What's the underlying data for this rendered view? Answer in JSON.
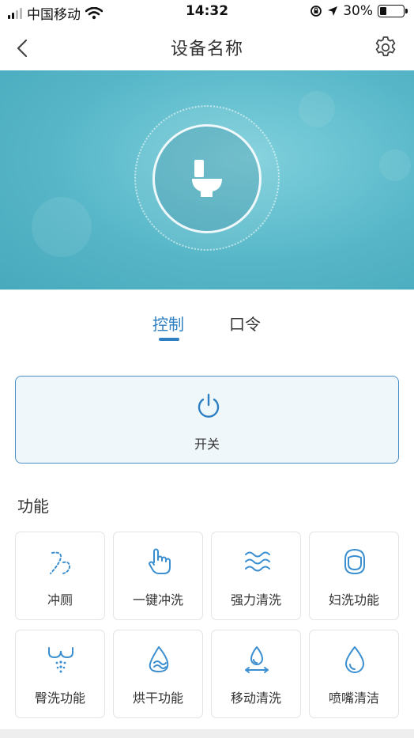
{
  "status_bar": {
    "carrier": "中国移动",
    "time": "14:32",
    "battery": "30%",
    "battery_level": 0.3
  },
  "nav": {
    "title": "设备名称",
    "back_icon": "chevron-left-icon",
    "settings_icon": "gear-icon"
  },
  "hero": {
    "device_icon": "toilet-icon"
  },
  "tabs": [
    {
      "label": "控制",
      "active": true
    },
    {
      "label": "口令",
      "active": false
    }
  ],
  "power": {
    "label": "开关",
    "icon": "power-icon"
  },
  "functions_title": "功能",
  "functions": [
    {
      "label": "冲厕",
      "icon": "flush-icon"
    },
    {
      "label": "一键冲洗",
      "icon": "touch-hand-icon"
    },
    {
      "label": "强力清洗",
      "icon": "waves-icon"
    },
    {
      "label": "妇洗功能",
      "icon": "face-outline-icon"
    },
    {
      "label": "臀洗功能",
      "icon": "spray-icon"
    },
    {
      "label": "烘干功能",
      "icon": "dry-flame-icon"
    },
    {
      "label": "移动清洗",
      "icon": "moving-drop-icon"
    },
    {
      "label": "喷嘴清洁",
      "icon": "drop-icon"
    }
  ],
  "colors": {
    "accent": "#2d7fc2",
    "hero": "#57b7c8",
    "icon": "#3b8fd0"
  }
}
